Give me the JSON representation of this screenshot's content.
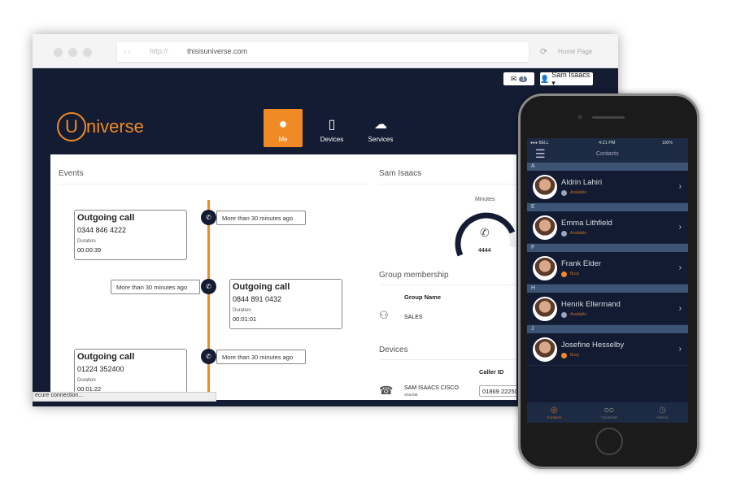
{
  "browser": {
    "url_prefix": "http://",
    "url": "thisisuniverse.com",
    "home_label": "Home Page",
    "inbox_count": "1",
    "user_menu": "Sam Isaacs ▾",
    "status_bar": "ecure connection..."
  },
  "app": {
    "logo_letter": "U",
    "logo_rest": "niverse",
    "nav": [
      {
        "label": "Me",
        "icon": "user-icon",
        "active": true
      },
      {
        "label": "Devices",
        "icon": "phone-icon"
      },
      {
        "label": "Services",
        "icon": "cloud-icon"
      }
    ],
    "accent": "#f08a24",
    "navy": "#141c33"
  },
  "events": {
    "title": "Events",
    "items": [
      {
        "title": "Outgoing call",
        "number": "0344 846 4222",
        "duration_label": "Duration",
        "duration": "00:00:39",
        "time": "More than 30 minutes ago",
        "side": "left"
      },
      {
        "title": "Outgoing call",
        "number": "0844 891 0432",
        "duration_label": "Duration",
        "duration": "00:01:01",
        "time": "More than 30 minutes ago",
        "side": "right"
      },
      {
        "title": "Outgoing call",
        "number": "01224 352400",
        "duration_label": "Duration",
        "duration": "00:01:22",
        "time": "More than 30 minutes ago",
        "side": "left"
      }
    ]
  },
  "profile": {
    "name": "Sam Isaacs",
    "minutes_label": "Minutes",
    "minutes_value": "4444",
    "group_title": "Group membership",
    "group_col": "Group Name",
    "group": "SALES",
    "devices_title": "Devices",
    "caller_id_col": "Caller ID",
    "device_name": "SAM ISAACS CISCO",
    "device_status": "ONLINE",
    "caller_id": "01869 22250"
  },
  "phone": {
    "carrier": "●●● BELL",
    "time": "4:21 PM",
    "battery": "100%",
    "title": "Contacts",
    "contacts": [
      {
        "section": "A",
        "name": "Aldrin Lahiri",
        "status": "Available",
        "color": "#9aa6bf"
      },
      {
        "section": "E",
        "name": "Emma Lithfield",
        "status": "Available",
        "color": "#9aa6bf"
      },
      {
        "section": "F",
        "name": "Frank Elder",
        "status": "Busy",
        "color": "#f08a24"
      },
      {
        "section": "H",
        "name": "Henrik Ellermand",
        "status": "Available",
        "color": "#9aa6bf"
      },
      {
        "section": "J",
        "name": "Josefine Hesselby",
        "status": "Busy",
        "color": "#f08a24"
      }
    ],
    "tabs": [
      {
        "label": "Contacts",
        "icon": "contacts-icon",
        "active": true
      },
      {
        "label": "Voicemail",
        "icon": "voicemail-icon"
      },
      {
        "label": "History",
        "icon": "clock-icon"
      }
    ]
  }
}
